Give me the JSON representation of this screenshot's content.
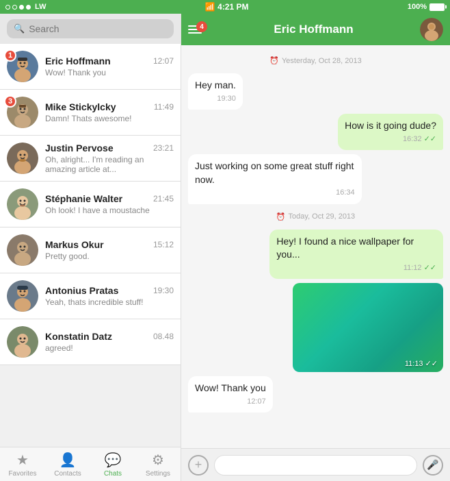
{
  "statusBar": {
    "signal": "LW",
    "wifi": true,
    "time": "4:21 PM",
    "battery": "100%"
  },
  "search": {
    "placeholder": "Search"
  },
  "chatList": [
    {
      "id": 1,
      "name": "Eric Hoffmann",
      "time": "12:07",
      "preview": "Wow! Thank you",
      "badge": 1,
      "avatarColor": "av1"
    },
    {
      "id": 2,
      "name": "Mike Stickylcky",
      "time": "11:49",
      "preview": "Damn! Thats awesome!",
      "badge": 3,
      "avatarColor": "av2"
    },
    {
      "id": 3,
      "name": "Justin Pervose",
      "time": "23:21",
      "preview": "Oh, alright... I'm reading an amazing article at...",
      "badge": 0,
      "avatarColor": "av3"
    },
    {
      "id": 4,
      "name": "Stéphanie Walter",
      "time": "21:45",
      "preview": "Oh look! I have a moustache",
      "badge": 0,
      "avatarColor": "av4"
    },
    {
      "id": 5,
      "name": "Markus Okur",
      "time": "15:12",
      "preview": "Pretty good.",
      "badge": 0,
      "avatarColor": "av5"
    },
    {
      "id": 6,
      "name": "Antonius Pratas",
      "time": "19:30",
      "preview": "Yeah, thats incredible stuff!",
      "badge": 0,
      "avatarColor": "av6"
    },
    {
      "id": 7,
      "name": "Konstatin Datz",
      "time": "08.48",
      "preview": "agreed!",
      "badge": 0,
      "avatarColor": "av7"
    }
  ],
  "bottomNav": [
    {
      "id": "favorites",
      "label": "Favorites",
      "icon": "★",
      "active": false
    },
    {
      "id": "contacts",
      "label": "Contacts",
      "icon": "👤",
      "active": false
    },
    {
      "id": "chats",
      "label": "Chats",
      "icon": "💬",
      "active": true
    },
    {
      "id": "settings",
      "label": "Settings",
      "icon": "⚙",
      "active": false
    }
  ],
  "activeChat": {
    "name": "Eric Hoffmann",
    "headerBadge": 4,
    "messages": [
      {
        "id": 1,
        "type": "date",
        "text": "Yesterday, Oct 28, 2013"
      },
      {
        "id": 2,
        "type": "incoming",
        "text": "Hey man.",
        "time": "19:30"
      },
      {
        "id": 3,
        "type": "outgoing",
        "text": "How is it going dude?",
        "time": "16:32",
        "ticks": "✓✓"
      },
      {
        "id": 4,
        "type": "incoming",
        "text": "Just working on some great stuff right now.",
        "time": "16:34"
      },
      {
        "id": 5,
        "type": "date",
        "text": "Today, Oct 29, 2013"
      },
      {
        "id": 6,
        "type": "outgoing",
        "text": "Hey! I found a nice wallpaper for you...",
        "time": "11:12",
        "ticks": "✓✓"
      },
      {
        "id": 7,
        "type": "outgoing-image",
        "time": "11:13",
        "ticks": "✓✓"
      },
      {
        "id": 8,
        "type": "incoming",
        "text": "Wow! Thank you",
        "time": "12:07"
      }
    ]
  },
  "chatInput": {
    "placeholder": ""
  }
}
